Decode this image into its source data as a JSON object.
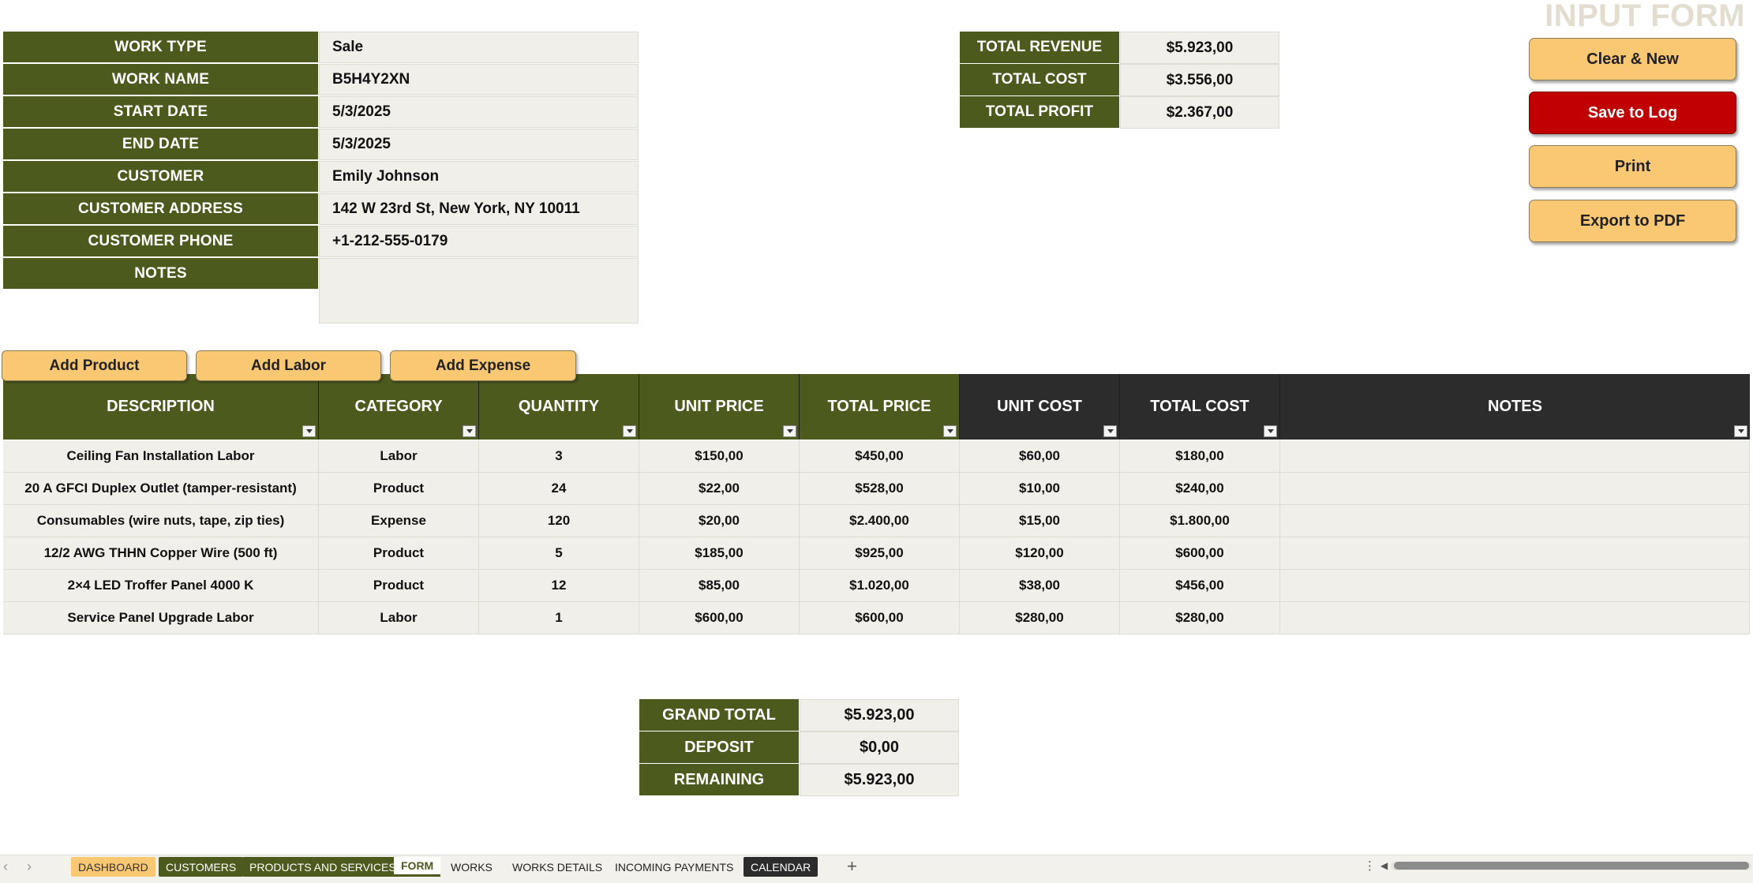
{
  "page": {
    "title": "INPUT FORM"
  },
  "colors": {
    "olive": "#4d5a1e",
    "dark_header": "#2c2c2c",
    "button_yellow": "#fac873",
    "button_red": "#c00000",
    "cell_bg": "#f1efe9"
  },
  "info": {
    "work_type": {
      "label": "WORK TYPE",
      "value": "Sale"
    },
    "work_name": {
      "label": "WORK NAME",
      "value": "B5H4Y2XN"
    },
    "start_date": {
      "label": "START DATE",
      "value": "5/3/2025"
    },
    "end_date": {
      "label": "END DATE",
      "value": "5/3/2025"
    },
    "customer": {
      "label": "CUSTOMER",
      "value": "Emily Johnson"
    },
    "customer_address": {
      "label": "CUSTOMER ADDRESS",
      "value": "142 W 23rd St, New York, NY 10011"
    },
    "customer_phone": {
      "label": "CUSTOMER PHONE",
      "value": "+1-212-555-0179"
    },
    "notes": {
      "label": "NOTES",
      "value": ""
    }
  },
  "summary": {
    "revenue": {
      "label": "TOTAL REVENUE",
      "value": "$5.923,00"
    },
    "cost": {
      "label": "TOTAL COST",
      "value": "$3.556,00"
    },
    "profit": {
      "label": "TOTAL PROFIT",
      "value": "$2.367,00"
    }
  },
  "actions": {
    "clear_new": "Clear & New",
    "save_log": "Save to Log",
    "print": "Print",
    "export_pdf": "Export to PDF"
  },
  "add_buttons": {
    "product": "Add Product",
    "labor": "Add Labor",
    "expense": "Add Expense"
  },
  "table": {
    "headers": [
      "DESCRIPTION",
      "CATEGORY",
      "QUANTITY",
      "UNIT PRICE",
      "TOTAL PRICE",
      "UNIT COST",
      "TOTAL COST",
      "NOTES"
    ],
    "rows": [
      [
        "Ceiling Fan Installation Labor",
        "Labor",
        "3",
        "$150,00",
        "$450,00",
        "$60,00",
        "$180,00",
        ""
      ],
      [
        "20 A GFCI Duplex Outlet (tamper-resistant)",
        "Product",
        "24",
        "$22,00",
        "$528,00",
        "$10,00",
        "$240,00",
        ""
      ],
      [
        "Consumables (wire nuts, tape, zip ties)",
        "Expense",
        "120",
        "$20,00",
        "$2.400,00",
        "$15,00",
        "$1.800,00",
        ""
      ],
      [
        "12/2 AWG THHN Copper Wire (500 ft)",
        "Product",
        "5",
        "$185,00",
        "$925,00",
        "$120,00",
        "$600,00",
        ""
      ],
      [
        "2×4 LED Troffer Panel 4000 K",
        "Product",
        "12",
        "$85,00",
        "$1.020,00",
        "$38,00",
        "$456,00",
        ""
      ],
      [
        "Service Panel Upgrade Labor",
        "Labor",
        "1",
        "$600,00",
        "$600,00",
        "$280,00",
        "$280,00",
        ""
      ]
    ]
  },
  "totals": {
    "grand_total": {
      "label": "GRAND TOTAL",
      "value": "$5.923,00"
    },
    "deposit": {
      "label": "DEPOSIT",
      "value": "$0,00"
    },
    "remaining": {
      "label": "REMAINING",
      "value": "$5.923,00"
    }
  },
  "sheet_tabs": [
    "DASHBOARD",
    "CUSTOMERS",
    "PRODUCTS AND SERVICES",
    "FORM",
    "WORKS",
    "WORKS DETAILS",
    "INCOMING PAYMENTS",
    "CALENDAR"
  ],
  "tabbar_icons": {
    "prev": "chevron-left-icon",
    "next": "chevron-right-icon",
    "add": "plus-icon",
    "more": "vertical-dots-icon",
    "scroll_left": "triangle-left-icon"
  }
}
